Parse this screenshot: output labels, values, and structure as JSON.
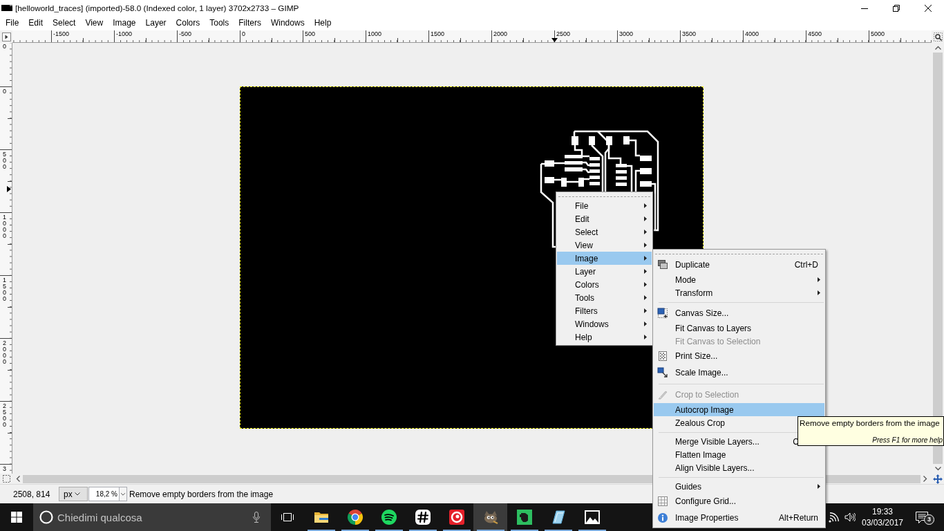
{
  "window": {
    "title": "[helloworld_traces] (imported)-58.0 (Indexed color, 1 layer) 3702x2733 – GIMP"
  },
  "menubar": [
    "File",
    "Edit",
    "Select",
    "View",
    "Image",
    "Layer",
    "Colors",
    "Tools",
    "Filters",
    "Windows",
    "Help"
  ],
  "horizontal_ruler": {
    "labels": [
      "-1500",
      "-1000",
      "-500",
      "0",
      "500",
      "1000",
      "1500",
      "2000",
      "2500",
      "3000",
      "3500",
      "4000",
      "4500",
      "5000"
    ]
  },
  "vertical_ruler": {
    "partial_label": "0",
    "labels": [
      "0",
      "500",
      "1000",
      "1500",
      "2000",
      "2500"
    ],
    "partial_bottom_label": "3"
  },
  "context_menu": {
    "items": [
      {
        "label": "File",
        "kind": "submenu",
        "selected": false
      },
      {
        "label": "Edit",
        "kind": "submenu",
        "selected": false
      },
      {
        "label": "Select",
        "kind": "submenu",
        "selected": false
      },
      {
        "label": "View",
        "kind": "submenu",
        "selected": false
      },
      {
        "label": "Image",
        "kind": "submenu",
        "selected": true
      },
      {
        "label": "Layer",
        "kind": "submenu",
        "selected": false
      },
      {
        "label": "Colors",
        "kind": "submenu",
        "selected": false
      },
      {
        "label": "Tools",
        "kind": "submenu",
        "selected": false
      },
      {
        "label": "Filters",
        "kind": "submenu",
        "selected": false
      },
      {
        "label": "Windows",
        "kind": "submenu",
        "selected": false
      },
      {
        "label": "Help",
        "kind": "submenu",
        "selected": false
      }
    ]
  },
  "submenu": {
    "items": [
      {
        "kind": "icon-item",
        "label": "Duplicate",
        "shortcut": "Ctrl+D",
        "disabled": false,
        "selected": false
      },
      {
        "kind": "submenu",
        "label": "Mode",
        "disabled": false,
        "selected": false
      },
      {
        "kind": "submenu",
        "label": "Transform",
        "disabled": false,
        "selected": false
      },
      {
        "kind": "separator"
      },
      {
        "kind": "icon-item",
        "label": "Canvas Size...",
        "disabled": false,
        "selected": false
      },
      {
        "kind": "item",
        "label": "Fit Canvas to Layers",
        "disabled": false,
        "selected": false
      },
      {
        "kind": "item",
        "label": "Fit Canvas to Selection",
        "disabled": true,
        "selected": false
      },
      {
        "kind": "icon-item",
        "label": "Print Size...",
        "disabled": false,
        "selected": false
      },
      {
        "kind": "icon-item",
        "label": "Scale Image...",
        "disabled": false,
        "selected": false
      },
      {
        "kind": "separator"
      },
      {
        "kind": "icon-item",
        "label": "Crop to Selection",
        "disabled": true,
        "selected": false
      },
      {
        "kind": "item",
        "label": "Autocrop Image",
        "disabled": false,
        "selected": true
      },
      {
        "kind": "item",
        "label": "Zealous Crop",
        "disabled": false,
        "selected": false
      },
      {
        "kind": "separator"
      },
      {
        "kind": "item",
        "label": "Merge Visible Layers...",
        "shortcut": "C",
        "shortcut_covered": true,
        "disabled": false,
        "selected": false
      },
      {
        "kind": "item",
        "label": "Flatten Image",
        "disabled": false,
        "selected": false
      },
      {
        "kind": "item",
        "label": "Align Visible Layers...",
        "disabled": false,
        "selected": false
      },
      {
        "kind": "separator"
      },
      {
        "kind": "submenu",
        "label": "Guides",
        "disabled": false,
        "selected": false
      },
      {
        "kind": "icon-item",
        "label": "Configure Grid...",
        "disabled": false,
        "selected": false
      },
      {
        "kind": "icon-item",
        "label": "Image Properties",
        "shortcut": "Alt+Return",
        "disabled": false,
        "selected": false
      }
    ]
  },
  "tooltip": {
    "text": "Remove empty borders from the image",
    "hint": "Press F1 for more help"
  },
  "status_bar": {
    "coordinates": "2508, 814",
    "unit": "px",
    "zoom": "18,2 %",
    "message": "Remove empty borders from the image"
  },
  "taskbar": {
    "search": {
      "placeholder": "Chiedimi qualcosa"
    },
    "apps": [
      {
        "kind": "folder",
        "running": true,
        "active": false
      },
      {
        "kind": "browser",
        "running": true,
        "active": false
      },
      {
        "kind": "music",
        "running": true,
        "active": false
      },
      {
        "kind": "hash",
        "running": true,
        "active": false
      },
      {
        "kind": "ring",
        "running": true,
        "active": false
      },
      {
        "kind": "painter",
        "running": true,
        "active": true
      },
      {
        "kind": "notes",
        "running": true,
        "active": false
      },
      {
        "kind": "glass",
        "running": true,
        "active": false
      },
      {
        "kind": "photos",
        "running": true,
        "active": false
      }
    ],
    "clock": {
      "time": "19:33",
      "date": "03/03/2017"
    },
    "notification_count": "3"
  }
}
